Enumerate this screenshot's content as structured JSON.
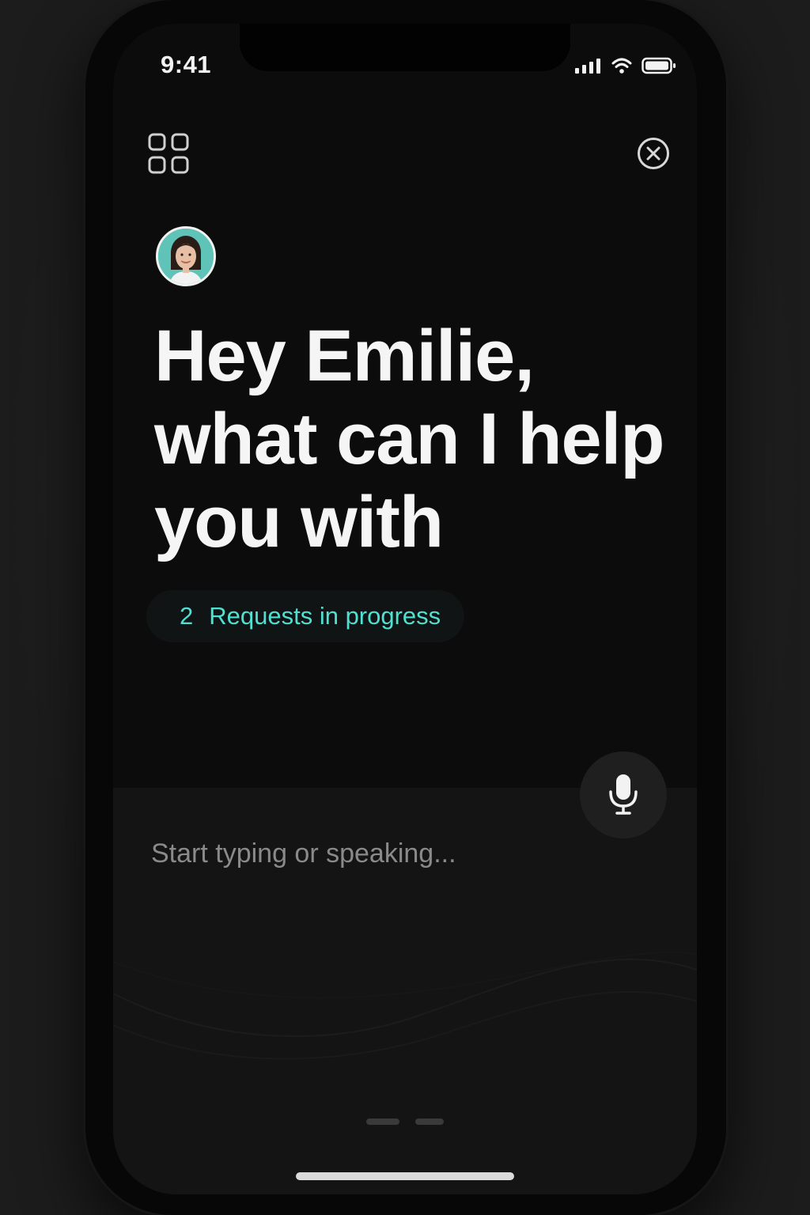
{
  "status_bar": {
    "time": "9:41"
  },
  "header": {
    "grid_icon": "grid-icon",
    "close_icon": "close-icon"
  },
  "greeting": {
    "line1": "Hey Emilie,",
    "line2": "what can I help",
    "line3": "you with"
  },
  "requests": {
    "count": "2",
    "label": "Requests in progress"
  },
  "composer": {
    "placeholder": "Start typing or speaking...",
    "mic_icon": "microphone-icon"
  },
  "colors": {
    "accent": "#4fe0d2",
    "background": "#0c0c0c",
    "text": "#f5f5f5",
    "placeholder": "#8a8a8a"
  }
}
